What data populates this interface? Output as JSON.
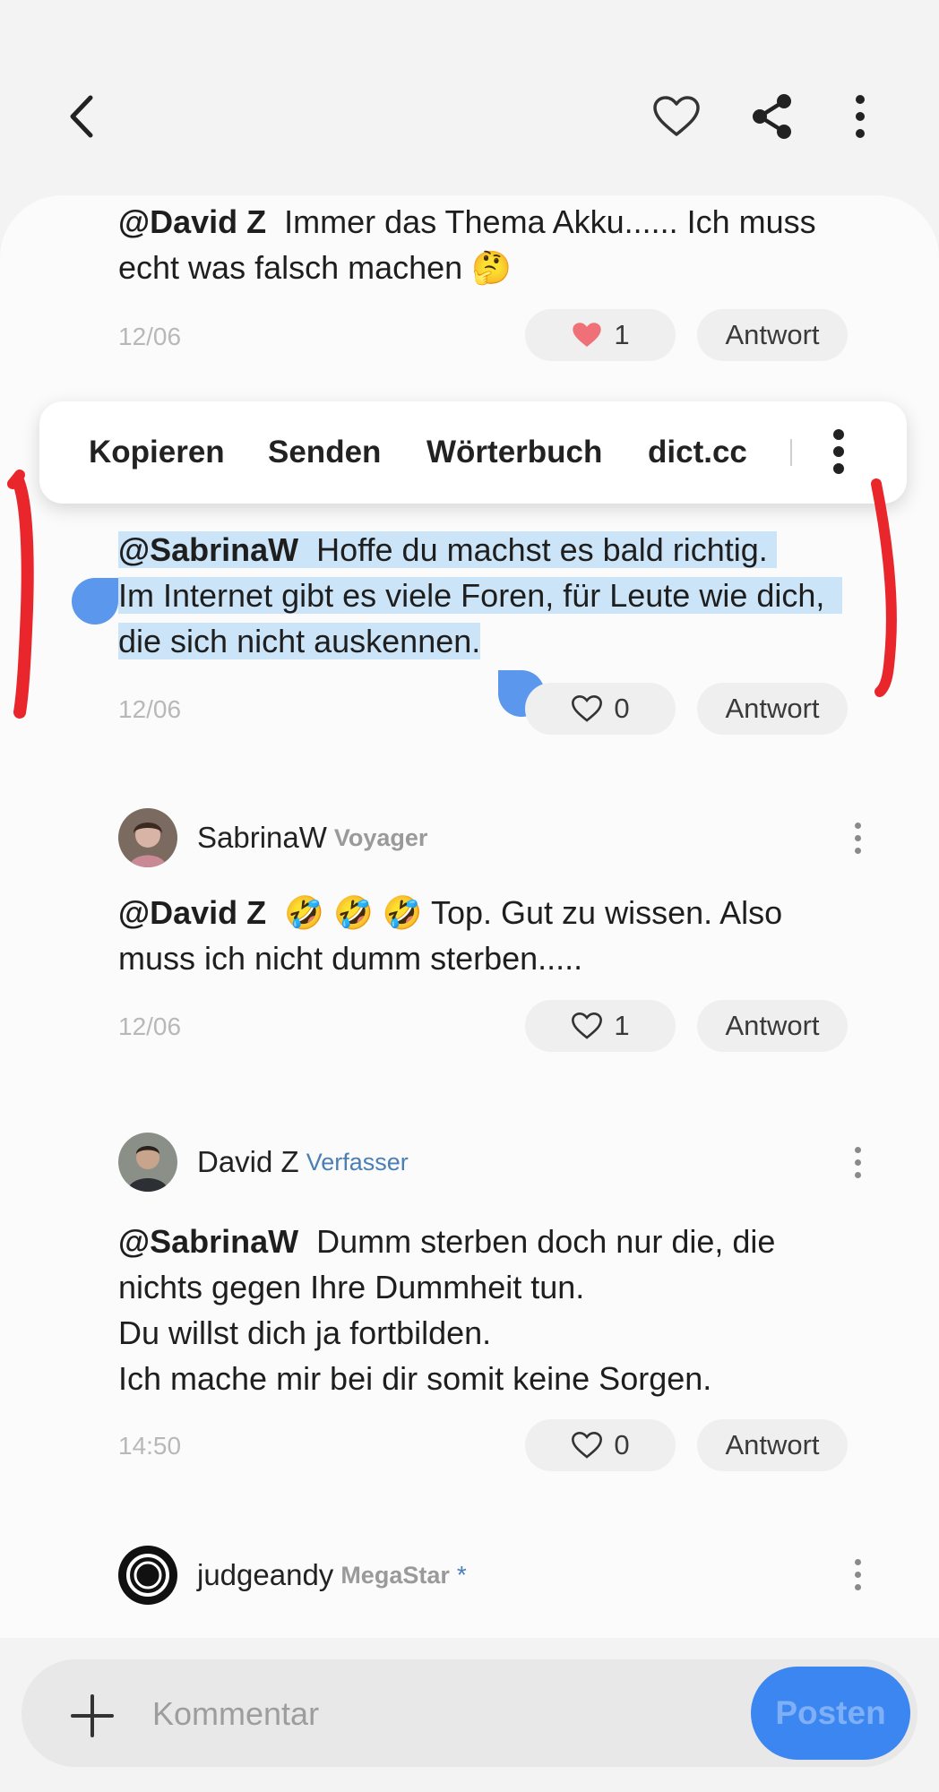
{
  "header": {
    "back_icon": "chevron-left-icon",
    "favorite_icon": "heart-outline-icon",
    "share_icon": "share-icon",
    "more_icon": "more-vertical-icon"
  },
  "comments": [
    {
      "mention": "@David Z",
      "text_lines": [
        "Immer das Thema Akku...... Ich muss",
        "echt was falsch machen 🤔"
      ],
      "date": "12/06",
      "likes": "1",
      "liked": true,
      "reply_label": "Antwort"
    },
    {
      "mention": "@SabrinaW",
      "text_lines": [
        "Hoffe du machst es bald richtig.",
        "Im Internet gibt es viele Foren, für Leute wie dich,",
        "die sich nicht auskennen."
      ],
      "date": "12/06",
      "likes": "0",
      "liked": false,
      "reply_label": "Antwort"
    },
    {
      "author": "SabrinaW",
      "role": "Voyager",
      "mention": "@David Z",
      "text_lines": [
        "🤣 🤣 🤣 Top. Gut zu wissen. Also",
        "muss ich nicht dumm sterben....."
      ],
      "date": "12/06",
      "likes": "1",
      "liked": false,
      "reply_label": "Antwort"
    },
    {
      "author": "David Z",
      "role": "Verfasser",
      "mention": "@SabrinaW",
      "text_lines": [
        "Dumm sterben doch nur die, die",
        "nichts gegen Ihre Dummheit tun.",
        "Du willst dich ja fortbilden.",
        "Ich mache mir bei dir somit keine Sorgen."
      ],
      "date": "14:50",
      "likes": "0",
      "liked": false,
      "reply_label": "Antwort"
    },
    {
      "author": "judgeandy",
      "role": "MegaStar",
      "role_badge": "*"
    }
  ],
  "selection_menu": {
    "items": [
      "Kopieren",
      "Senden",
      "Wörterbuch",
      "dict.cc"
    ],
    "more_icon": "more-vertical-icon"
  },
  "composer": {
    "add_icon": "plus-icon",
    "placeholder": "Kommentar",
    "post_label": "Posten"
  },
  "colors": {
    "accent": "#3b86f0",
    "selection": "#cce4f7",
    "annotation": "#e8262b",
    "role_blue": "#4a7fb5",
    "role_gray": "#9a9a9a",
    "liked_heart": "#f07078"
  }
}
